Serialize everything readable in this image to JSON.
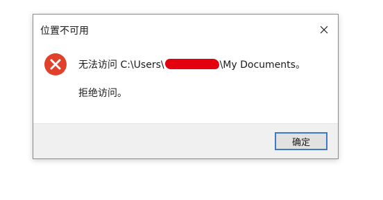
{
  "dialog": {
    "title": "位置不可用",
    "close_icon": "close-icon",
    "error_icon": "error-icon",
    "message_prefix": "无法访问 C:\\Users\\",
    "message_suffix": "\\My Documents。",
    "detail": "拒绝访问。",
    "ok_label": "确定"
  },
  "colors": {
    "error_icon_bg": "#e0412a",
    "ok_border": "#3c78c8",
    "footer_bg": "#f0f0f0",
    "redaction": "#e3000f"
  }
}
